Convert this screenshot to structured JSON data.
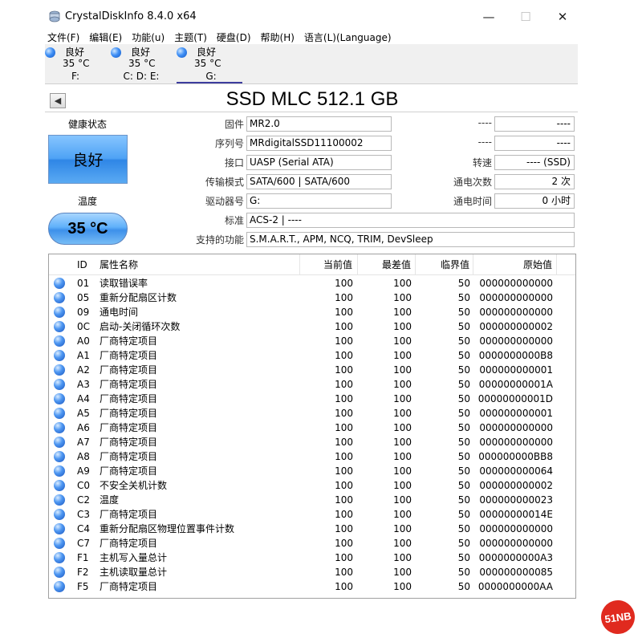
{
  "window": {
    "title": "CrystalDiskInfo 8.4.0 x64",
    "minimize_glyph": "—",
    "maximize_glyph": "☐",
    "close_glyph": "✕"
  },
  "menu": [
    "文件(F)",
    "编辑(E)",
    "功能(u)",
    "主题(T)",
    "硬盘(D)",
    "帮助(H)",
    "语言(L)(Language)"
  ],
  "drives": [
    {
      "status": "良好",
      "temp": "35 °C",
      "letter": "F:",
      "active": false
    },
    {
      "status": "良好",
      "temp": "35 °C",
      "letter": "C: D: E:",
      "active": false
    },
    {
      "status": "良好",
      "temp": "35 °C",
      "letter": "G:",
      "active": true
    }
  ],
  "disk": {
    "title": "SSD MLC 512.1 GB",
    "back_glyph": "◀"
  },
  "health": {
    "label": "健康状态",
    "value": "良好",
    "color": "#4fa3f5"
  },
  "temperature": {
    "label": "温度",
    "value": "35 °C"
  },
  "info": {
    "firmware_label": "固件",
    "firmware": "MR2.0",
    "serial_label": "序列号",
    "serial": "MRdigitalSSD11100002",
    "interface_label": "接口",
    "interface": "UASP (Serial ATA)",
    "transfer_label": "传输模式",
    "transfer": "SATA/600 | SATA/600",
    "drive_label": "驱动器号",
    "drive": "G:",
    "standard_label": "标准",
    "standard": "ACS-2 | ----",
    "features_label": "支持的功能",
    "features": "S.M.A.R.T., APM, NCQ, TRIM, DevSleep",
    "right1_label": "----",
    "right1": "----",
    "right2_label": "----",
    "right2": "----",
    "rotation_label": "转速",
    "rotation": "---- (SSD)",
    "power_count_label": "通电次数",
    "power_count": "2 次",
    "power_hours_label": "通电时间",
    "power_hours": "0 小时"
  },
  "table": {
    "headers": {
      "id": "ID",
      "name": "属性名称",
      "current": "当前值",
      "worst": "最差值",
      "threshold": "临界值",
      "raw": "原始值"
    },
    "rows": [
      {
        "id": "01",
        "name": "读取错误率",
        "current": "100",
        "worst": "100",
        "threshold": "50",
        "raw": "000000000000"
      },
      {
        "id": "05",
        "name": "重新分配扇区计数",
        "current": "100",
        "worst": "100",
        "threshold": "50",
        "raw": "000000000000"
      },
      {
        "id": "09",
        "name": "通电时间",
        "current": "100",
        "worst": "100",
        "threshold": "50",
        "raw": "000000000000"
      },
      {
        "id": "0C",
        "name": "启动-关闭循环次数",
        "current": "100",
        "worst": "100",
        "threshold": "50",
        "raw": "000000000002"
      },
      {
        "id": "A0",
        "name": "厂商特定项目",
        "current": "100",
        "worst": "100",
        "threshold": "50",
        "raw": "000000000000"
      },
      {
        "id": "A1",
        "name": "厂商特定项目",
        "current": "100",
        "worst": "100",
        "threshold": "50",
        "raw": "0000000000B8"
      },
      {
        "id": "A2",
        "name": "厂商特定项目",
        "current": "100",
        "worst": "100",
        "threshold": "50",
        "raw": "000000000001"
      },
      {
        "id": "A3",
        "name": "厂商特定项目",
        "current": "100",
        "worst": "100",
        "threshold": "50",
        "raw": "00000000001A"
      },
      {
        "id": "A4",
        "name": "厂商特定项目",
        "current": "100",
        "worst": "100",
        "threshold": "50",
        "raw": "00000000001D"
      },
      {
        "id": "A5",
        "name": "厂商特定项目",
        "current": "100",
        "worst": "100",
        "threshold": "50",
        "raw": "000000000001"
      },
      {
        "id": "A6",
        "name": "厂商特定项目",
        "current": "100",
        "worst": "100",
        "threshold": "50",
        "raw": "000000000000"
      },
      {
        "id": "A7",
        "name": "厂商特定项目",
        "current": "100",
        "worst": "100",
        "threshold": "50",
        "raw": "000000000000"
      },
      {
        "id": "A8",
        "name": "厂商特定项目",
        "current": "100",
        "worst": "100",
        "threshold": "50",
        "raw": "000000000BB8"
      },
      {
        "id": "A9",
        "name": "厂商特定项目",
        "current": "100",
        "worst": "100",
        "threshold": "50",
        "raw": "000000000064"
      },
      {
        "id": "C0",
        "name": "不安全关机计数",
        "current": "100",
        "worst": "100",
        "threshold": "50",
        "raw": "000000000002"
      },
      {
        "id": "C2",
        "name": "温度",
        "current": "100",
        "worst": "100",
        "threshold": "50",
        "raw": "000000000023"
      },
      {
        "id": "C3",
        "name": "厂商特定项目",
        "current": "100",
        "worst": "100",
        "threshold": "50",
        "raw": "00000000014E"
      },
      {
        "id": "C4",
        "name": "重新分配扇区物理位置事件计数",
        "current": "100",
        "worst": "100",
        "threshold": "50",
        "raw": "000000000000"
      },
      {
        "id": "C7",
        "name": "厂商特定项目",
        "current": "100",
        "worst": "100",
        "threshold": "50",
        "raw": "000000000000"
      },
      {
        "id": "F1",
        "name": "主机写入量总计",
        "current": "100",
        "worst": "100",
        "threshold": "50",
        "raw": "0000000000A3"
      },
      {
        "id": "F2",
        "name": "主机读取量总计",
        "current": "100",
        "worst": "100",
        "threshold": "50",
        "raw": "000000000085"
      },
      {
        "id": "F5",
        "name": "厂商特定项目",
        "current": "100",
        "worst": "100",
        "threshold": "50",
        "raw": "0000000000AA"
      }
    ]
  },
  "watermark": "51NB"
}
